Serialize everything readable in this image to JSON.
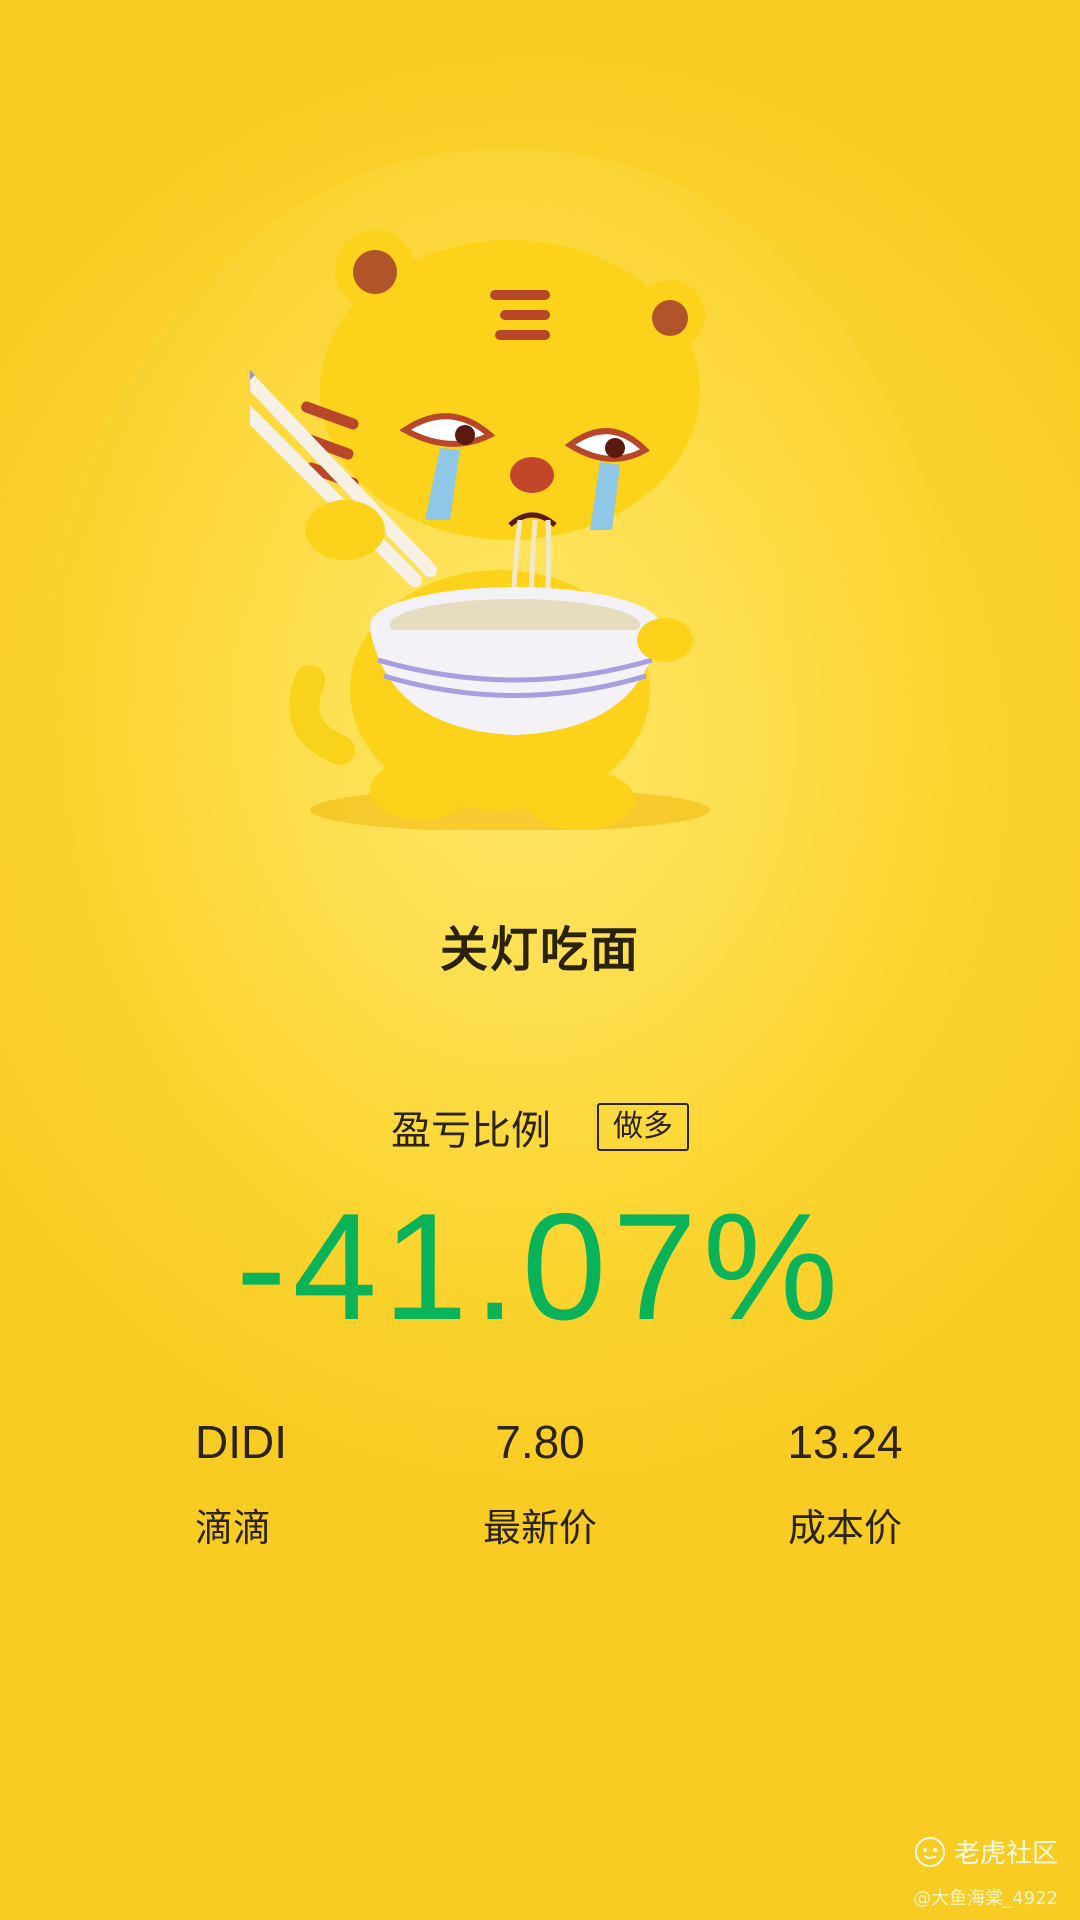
{
  "title": "关灯吃面",
  "ratio": {
    "label": "盈亏比例",
    "badge": "做多",
    "percent": "-41.07%"
  },
  "stats": [
    {
      "value": "DIDI",
      "label": "滴滴"
    },
    {
      "value": "7.80",
      "label": "最新价"
    },
    {
      "value": "13.24",
      "label": "成本价"
    }
  ],
  "footer": {
    "brand": "老虎社区",
    "user": "@大鱼海棠_4922"
  },
  "colors": {
    "accent": "#0ab35a",
    "background": "#fcd632"
  }
}
